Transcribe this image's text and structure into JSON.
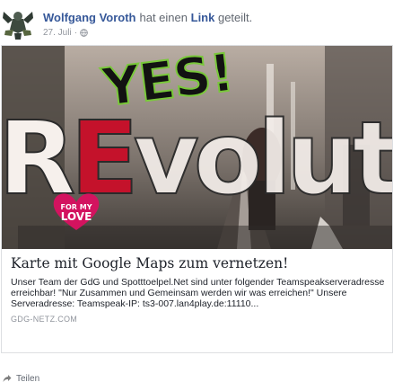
{
  "post": {
    "author_name": "Wolfgang Voroth",
    "shared_text": "hat einen",
    "link_word": "Link",
    "shared_suffix": " geteilt.",
    "date": "27. Juli",
    "separator": "·",
    "privacy_icon": "globe-icon"
  },
  "cover": {
    "yes": "YES!",
    "revolution_r": "R",
    "revolution_e": "E",
    "revolution_rest": "volution",
    "badge_line1": "FOR MY",
    "badge_line2": "LOVE"
  },
  "link": {
    "title": "Karte mit Google Maps zum vernetzen!",
    "description": "Unser Team der GdG und Spotttoelpel.Net sind unter folgender Teamspeakserveradresse erreichbar! \"Nur Zusammen und Gemeinsam werden wir was erreichen!\" Unsere Serveradresse: Teamspeak-IP: ts3-007.lan4play.de:11110...",
    "domain": "GDG-NETZ.COM"
  },
  "actions": {
    "share_label": "Teilen",
    "share_icon": "share-arrow-icon"
  },
  "colors": {
    "link_blue": "#365899",
    "muted_gray": "#616770",
    "accent_red": "#c4122b",
    "accent_green": "#79c83a"
  }
}
